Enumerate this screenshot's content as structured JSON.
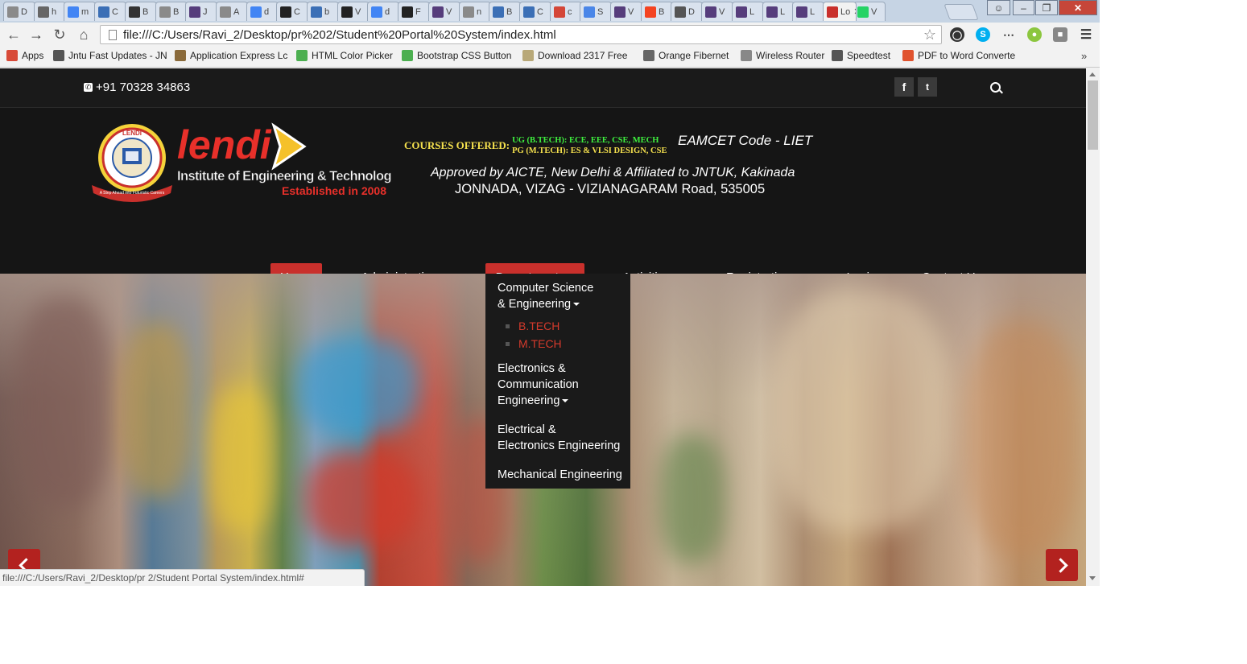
{
  "browser": {
    "tabs": [
      {
        "icon": "page-icon",
        "title": "D",
        "color": "#8a8a8a"
      },
      {
        "icon": "orange-fibernet-icon",
        "title": "h",
        "color": "#666666"
      },
      {
        "icon": "google-icon",
        "title": "m",
        "color": "#4285f4"
      },
      {
        "icon": "code-icon",
        "title": "C",
        "color": "#3b6fb6"
      },
      {
        "icon": "bold-b-icon",
        "title": "B",
        "color": "#333333"
      },
      {
        "icon": "page-icon",
        "title": "B",
        "color": "#8a8a8a"
      },
      {
        "icon": "bootstrap-icon",
        "title": "J",
        "color": "#563d7c"
      },
      {
        "icon": "page-icon",
        "title": "A",
        "color": "#8a8a8a"
      },
      {
        "icon": "google-icon",
        "title": "d",
        "color": "#4285f4"
      },
      {
        "icon": "github-icon",
        "title": "C",
        "color": "#222222"
      },
      {
        "icon": "c-icon",
        "title": "b",
        "color": "#3b6fb6"
      },
      {
        "icon": "github-icon",
        "title": "V",
        "color": "#222222"
      },
      {
        "icon": "google-icon",
        "title": "d",
        "color": "#4285f4"
      },
      {
        "icon": "github-icon",
        "title": "F",
        "color": "#222222"
      },
      {
        "icon": "bootstrap-icon",
        "title": "V",
        "color": "#563d7c"
      },
      {
        "icon": "page-icon",
        "title": "n",
        "color": "#8a8a8a"
      },
      {
        "icon": "code-icon",
        "title": "B",
        "color": "#3b6fb6"
      },
      {
        "icon": "code-icon",
        "title": "C",
        "color": "#3b6fb6"
      },
      {
        "icon": "gmail-icon",
        "title": "c",
        "color": "#d44638"
      },
      {
        "icon": "docs-icon",
        "title": "S",
        "color": "#4a86e8"
      },
      {
        "icon": "bootstrap-icon",
        "title": "V",
        "color": "#563d7c"
      },
      {
        "icon": "joomla-icon",
        "title": "B",
        "color": "#f44321"
      },
      {
        "icon": "download-icon",
        "title": "D",
        "color": "#555555"
      },
      {
        "icon": "bootstrap-icon",
        "title": "V",
        "color": "#563d7c"
      },
      {
        "icon": "bootstrap-icon",
        "title": "L",
        "color": "#563d7c"
      },
      {
        "icon": "bootstrap-icon",
        "title": "L",
        "color": "#563d7c"
      },
      {
        "icon": "bootstrap-icon",
        "title": "L",
        "color": "#563d7c"
      },
      {
        "icon": "lendi-icon",
        "title": "Lo",
        "color": "#c9302c",
        "active": true
      },
      {
        "icon": "whatsapp-icon",
        "title": "V",
        "color": "#25d366"
      }
    ],
    "url": "file:///C:/Users/Ravi_2/Desktop/pr%202/Student%20Portal%20System/index.html",
    "bookmarks": [
      {
        "icon": "apps-grid-icon",
        "label": "Apps"
      },
      {
        "icon": "graduation-cap-icon",
        "label": "Jntu Fast Updates - JN"
      },
      {
        "icon": "application-express-icon",
        "label": "Application Express Lc"
      },
      {
        "icon": "html-color-picker-icon",
        "label": "HTML Color Picker"
      },
      {
        "icon": "bootstrap-button-icon",
        "label": "Bootstrap CSS Button"
      },
      {
        "icon": "folder-icon",
        "label": "Download 2317 Free"
      },
      {
        "icon": "orange-fibernet-icon",
        "label": "Orange Fibernet"
      },
      {
        "icon": "page-icon",
        "label": "Wireless Router"
      },
      {
        "icon": "speedtest-icon",
        "label": "Speedtest"
      },
      {
        "icon": "pdf-icon",
        "label": "PDF to Word Converte"
      }
    ],
    "status_url": "file:///C:/Users/Ravi_2/Desktop/pr 2/Student Portal System/index.html#"
  },
  "site": {
    "phone": "+91 70328 34863",
    "social": [
      {
        "icon": "facebook-icon",
        "glyph": "f"
      },
      {
        "icon": "twitter-icon",
        "glyph": "t"
      }
    ],
    "logo": {
      "name": "lendi",
      "institute": "Institute of Engineering & Technology",
      "established": "Established in 2008",
      "seal_text": "LENDI",
      "motto": "A Step Ahead into Futuristic Careers"
    },
    "courses_label": "COURSES OFFERED:",
    "courses_ug": "UG (B.TECH): ECE, EEE, CSE, MECH",
    "courses_pg": "PG (M.TECH): ES & VLSI DESIGN, CSE",
    "eamcet": "EAMCET Code - LIET",
    "approved": "Approved by AICTE, New Delhi & Affiliated to JNTUK, Kakinada",
    "address": "JONNADA, VIZAG - VIZIANAGARAM Road, 535005",
    "nav": [
      {
        "label": "Home",
        "dropdown": false,
        "active": true
      },
      {
        "label": "Administration",
        "dropdown": true
      },
      {
        "label": "Departments",
        "dropdown": true,
        "active": true
      },
      {
        "label": "Activities",
        "dropdown": true
      },
      {
        "label": "Registration",
        "dropdown": true
      },
      {
        "label": "Login",
        "dropdown": false
      },
      {
        "label": "Contact Us",
        "dropdown": false
      }
    ],
    "departments_menu": [
      {
        "label_lines": [
          "Computer Science",
          "& Engineering"
        ],
        "has_caret": true,
        "sub": [
          "B.TECH",
          "M.TECH"
        ]
      },
      {
        "label_lines": [
          "Electronics &",
          "Communication",
          "Engineering"
        ],
        "has_caret": true
      },
      {
        "label_lines": [
          "Electrical &",
          "Electronics Engineering"
        ],
        "has_caret": false
      },
      {
        "label_lines": [
          "Mechanical Engineering"
        ],
        "has_caret": false
      }
    ]
  },
  "colors": {
    "accent_red": "#c9302c",
    "header_bg": "#151515",
    "courses_yellow": "#f4e04d",
    "courses_green": "#3ff03f",
    "submenu_red": "#d43a2c"
  }
}
